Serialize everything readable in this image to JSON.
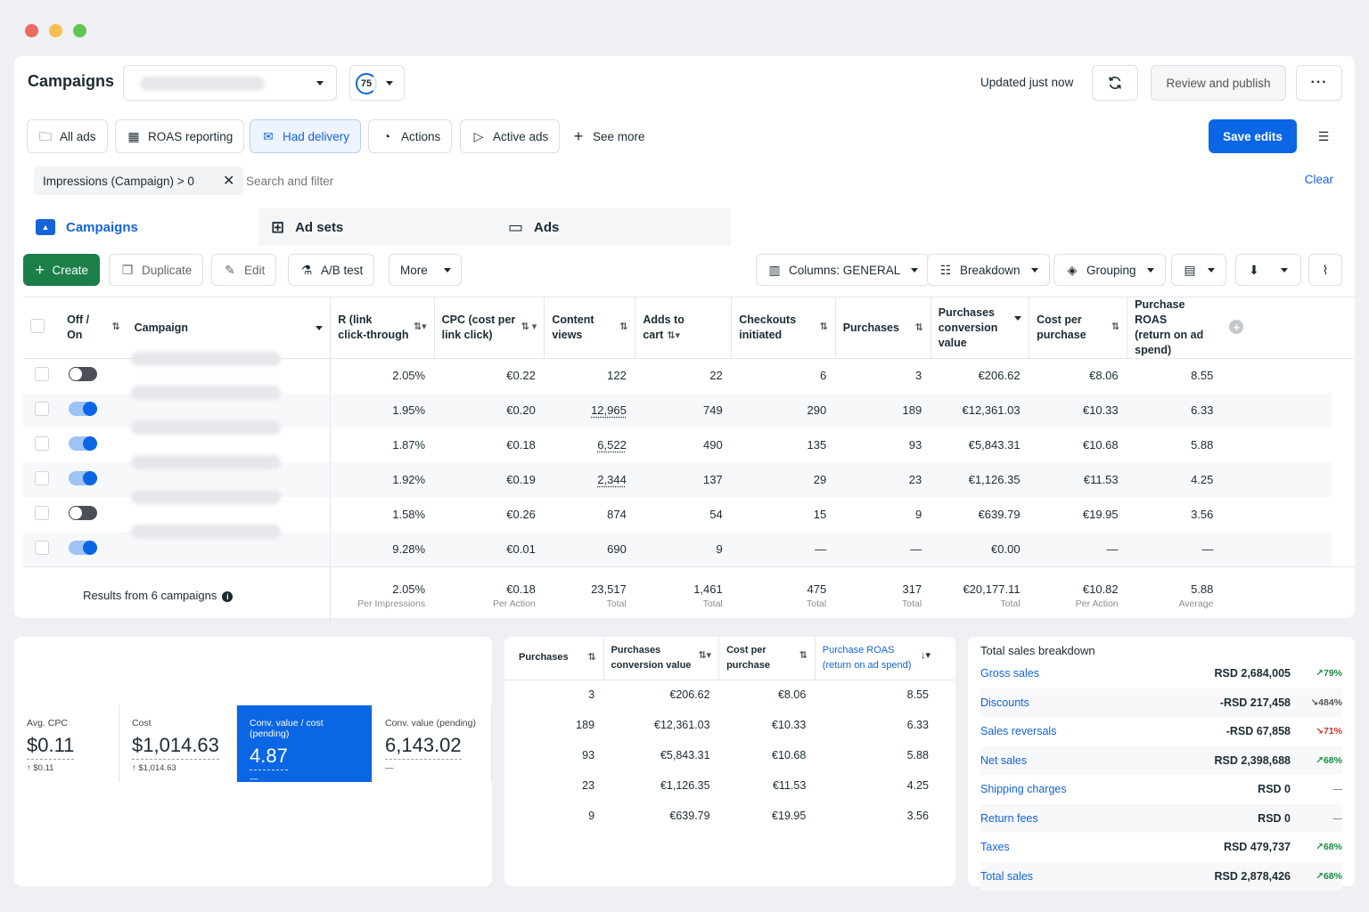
{
  "colors": {
    "accent": "#0a66e4",
    "create_green": "#1b7f47",
    "positive": "#1a8d3f",
    "negative": "#d32f2f"
  },
  "header": {
    "title": "Campaigns",
    "score": "75",
    "updated": "Updated just now",
    "review_publish": "Review and publish",
    "more_icon": "ellipsis-icon"
  },
  "toolbar": {
    "all_ads": "All ads",
    "roas_reporting": "ROAS reporting",
    "had_delivery": "Had delivery",
    "actions": "Actions",
    "active_ads": "Active ads",
    "see_more": "See more",
    "save_edits": "Save edits"
  },
  "filter": {
    "chip": "Impressions (Campaign) > 0",
    "placeholder": "Search and filter",
    "clear": "Clear"
  },
  "tabs": {
    "campaigns": "Campaigns",
    "ad_sets": "Ad sets",
    "ads": "Ads"
  },
  "actions": {
    "create": "Create",
    "duplicate": "Duplicate",
    "edit": "Edit",
    "ab_test": "A/B test",
    "more": "More",
    "columns": "Columns: GENERAL",
    "breakdown": "Breakdown",
    "grouping": "Grouping"
  },
  "table": {
    "headers": {
      "offon1": "Off /",
      "offon2": "On",
      "campaign": "Campaign",
      "ctr1": "R (link",
      "ctr2": "click-through",
      "cpc1": "CPC (cost per",
      "cpc2": "link click)",
      "cv1": "Content",
      "cv2": "views",
      "atc": "Adds to cart",
      "ci1": "Checkouts",
      "ci2": "initiated",
      "purchases": "Purchases",
      "pcv1": "Purchases",
      "pcv2": "conversion value",
      "cpp1": "Cost per",
      "cpp2": "purchase",
      "roas1": "Purchase ROAS",
      "roas2": "(return on ad spend)"
    },
    "rows": [
      {
        "on": false,
        "ctr": "2.05%",
        "cpc": "€0.22",
        "cv": "122",
        "cv_link": false,
        "atc": "22",
        "ci": "6",
        "pur": "3",
        "pcv": "€206.62",
        "cpp": "€8.06",
        "roas": "8.55"
      },
      {
        "on": true,
        "ctr": "1.95%",
        "cpc": "€0.20",
        "cv": "12,965",
        "cv_link": true,
        "atc": "749",
        "ci": "290",
        "pur": "189",
        "pcv": "€12,361.03",
        "cpp": "€10.33",
        "roas": "6.33"
      },
      {
        "on": true,
        "ctr": "1.87%",
        "cpc": "€0.18",
        "cv": "6,522",
        "cv_link": true,
        "atc": "490",
        "ci": "135",
        "pur": "93",
        "pcv": "€5,843.31",
        "cpp": "€10.68",
        "roas": "5.88"
      },
      {
        "on": true,
        "ctr": "1.92%",
        "cpc": "€0.19",
        "cv": "2,344",
        "cv_link": true,
        "atc": "137",
        "ci": "29",
        "pur": "23",
        "pcv": "€1,126.35",
        "cpp": "€11.53",
        "roas": "4.25"
      },
      {
        "on": false,
        "ctr": "1.58%",
        "cpc": "€0.26",
        "cv": "874",
        "cv_link": false,
        "atc": "54",
        "ci": "15",
        "pur": "9",
        "pcv": "€639.79",
        "cpp": "€19.95",
        "roas": "3.56"
      },
      {
        "on": true,
        "ctr": "9.28%",
        "cpc": "€0.01",
        "cv": "690",
        "cv_link": false,
        "atc": "9",
        "ci": "—",
        "pur": "—",
        "pcv": "€0.00",
        "cpp": "—",
        "roas": "—"
      }
    ],
    "summary": {
      "label": "Results from 6 campaigns",
      "ctr": "2.05%",
      "ctr_sub": "Per Impressions",
      "cpc": "€0.18",
      "cpc_sub": "Per Action",
      "cv": "23,517",
      "cv_sub": "Total",
      "atc": "1,461",
      "atc_sub": "Total",
      "ci": "475",
      "ci_sub": "Total",
      "pur": "317",
      "pur_sub": "Total",
      "pcv": "€20,177.11",
      "pcv_sub": "Total",
      "cpp": "€10.82",
      "cpp_sub": "Per Action",
      "roas": "5.88",
      "roas_sub": "Average"
    }
  },
  "metrics": [
    {
      "label": "Avg. CPC",
      "value": "$0.11",
      "delta": "↑ $0.11"
    },
    {
      "label": "Cost",
      "value": "$1,014.63",
      "delta": "↑ $1,014.63"
    },
    {
      "label": "Conv. value / cost (pending)",
      "value": "4.87",
      "delta": "—"
    },
    {
      "label": "Conv. value (pending)",
      "value": "6,143.02",
      "delta": "—"
    }
  ],
  "mini": {
    "h_pur": "Purchases",
    "h_pcv1": "Purchases",
    "h_pcv2": "conversion value",
    "h_cpp1": "Cost per",
    "h_cpp2": "purchase",
    "h_roas1": "Purchase ROAS",
    "h_roas2": "(return on ad spend)",
    "rows": [
      {
        "pur": "3",
        "pcv": "€206.62",
        "cpp": "€8.06",
        "roas": "8.55"
      },
      {
        "pur": "189",
        "pcv": "€12,361.03",
        "cpp": "€10.33",
        "roas": "6.33"
      },
      {
        "pur": "93",
        "pcv": "€5,843.31",
        "cpp": "€10.68",
        "roas": "5.88"
      },
      {
        "pur": "23",
        "pcv": "€1,126.35",
        "cpp": "€11.53",
        "roas": "4.25"
      },
      {
        "pur": "9",
        "pcv": "€639.79",
        "cpp": "€19.95",
        "roas": "3.56"
      }
    ]
  },
  "sales": {
    "title": "Total sales breakdown",
    "rows": [
      {
        "k": "Gross sales",
        "v": "RSD 2,684,005",
        "d": "↗79%",
        "dir": "up"
      },
      {
        "k": "Discounts",
        "v": "-RSD 217,458",
        "d": "↘484%",
        "dir": "down-neutral"
      },
      {
        "k": "Sales reversals",
        "v": "-RSD 67,858",
        "d": "↘71%",
        "dir": "down"
      },
      {
        "k": "Net sales",
        "v": "RSD 2,398,688",
        "d": "↗68%",
        "dir": "up"
      },
      {
        "k": "Shipping charges",
        "v": "RSD 0",
        "d": "—",
        "dir": "none"
      },
      {
        "k": "Return fees",
        "v": "RSD 0",
        "d": "—",
        "dir": "none"
      },
      {
        "k": "Taxes",
        "v": "RSD 479,737",
        "d": "↗68%",
        "dir": "up"
      },
      {
        "k": "Total sales",
        "v": "RSD 2,878,426",
        "d": "↗68%",
        "dir": "up"
      }
    ]
  }
}
